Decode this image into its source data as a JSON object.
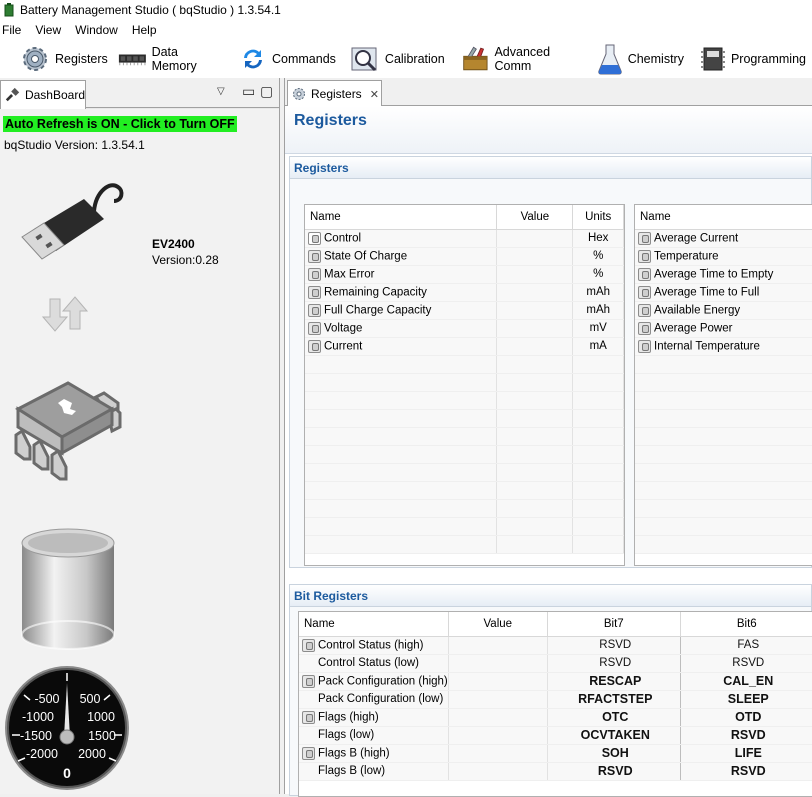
{
  "window": {
    "title": "Battery Management Studio ( bqStudio ) 1.3.54.1"
  },
  "menu": [
    "File",
    "View",
    "Window",
    "Help"
  ],
  "toolbar": [
    {
      "label": "Registers",
      "icon": "gear-icon"
    },
    {
      "label": "Data Memory",
      "icon": "memory-chip-icon"
    },
    {
      "label": "Commands",
      "icon": "refresh-arrows-icon"
    },
    {
      "label": "Calibration",
      "icon": "magnifier-calibration-icon"
    },
    {
      "label": "Advanced Comm",
      "icon": "toolbox-icon"
    },
    {
      "label": "Chemistry",
      "icon": "flask-icon"
    },
    {
      "label": "Programming",
      "icon": "programming-chip-icon"
    }
  ],
  "dashboard": {
    "tab_label": "DashBoard",
    "refresh_label": "Auto Refresh is ON - Click to Turn OFF",
    "version_label": "bqStudio Version:  1.3.54.1",
    "device_name": "EV2400",
    "device_version": "Version:0.28",
    "gauge": {
      "ticks": [
        "-500",
        "500",
        "-1000",
        "1000",
        "-1500",
        "1500",
        "-2000",
        "2000"
      ],
      "value": "0"
    }
  },
  "registers_tab": {
    "label": "Registers"
  },
  "page_title": "Registers",
  "registers_section": {
    "title": "Registers",
    "left_table": {
      "headers": {
        "name": "Name",
        "value": "Value",
        "units": "Units"
      },
      "rows": [
        {
          "name": "Control",
          "value": "",
          "units": "Hex",
          "icon": "edit"
        },
        {
          "name": "State Of Charge",
          "value": "",
          "units": "%",
          "icon": "lock"
        },
        {
          "name": "Max Error",
          "value": "",
          "units": "%",
          "icon": "lock"
        },
        {
          "name": "Remaining Capacity",
          "value": "",
          "units": "mAh",
          "icon": "lock"
        },
        {
          "name": "Full Charge Capacity",
          "value": "",
          "units": "mAh",
          "icon": "lock"
        },
        {
          "name": "Voltage",
          "value": "",
          "units": "mV",
          "icon": "lock"
        },
        {
          "name": "Current",
          "value": "",
          "units": "mA",
          "icon": "lock"
        }
      ]
    },
    "right_table": {
      "headers": {
        "name": "Name"
      },
      "rows": [
        "Average Current",
        "Temperature",
        "Average Time to Empty",
        "Average Time to Full",
        "Available Energy",
        "Average Power",
        "Internal Temperature"
      ]
    }
  },
  "bit_section": {
    "title": "Bit Registers",
    "headers": {
      "name": "Name",
      "value": "Value",
      "bit7": "Bit7",
      "bit6": "Bit6"
    },
    "rows": [
      {
        "name": "Control Status (high)",
        "lock": true,
        "bit7": "RSVD",
        "bit6": "FAS",
        "bold": false
      },
      {
        "name": "Control Status (low)",
        "lock": false,
        "bit7": "RSVD",
        "bit6": "RSVD",
        "bold": false
      },
      {
        "name": "Pack Configuration (high)",
        "lock": true,
        "bit7": "RESCAP",
        "bit6": "CAL_EN",
        "bold": true
      },
      {
        "name": "Pack Configuration (low)",
        "lock": false,
        "bit7": "RFACTSTEP",
        "bit6": "SLEEP",
        "bold": true
      },
      {
        "name": "Flags (high)",
        "lock": true,
        "bit7": "OTC",
        "bit6": "OTD",
        "bold": true
      },
      {
        "name": "Flags (low)",
        "lock": false,
        "bit7": "OCVTAKEN",
        "bit6": "RSVD",
        "bold": true
      },
      {
        "name": "Flags B (high)",
        "lock": true,
        "bit7": "SOH",
        "bit6": "LIFE",
        "bold": true
      },
      {
        "name": "Flags B (low)",
        "lock": false,
        "bit7": "RSVD",
        "bit6": "RSVD",
        "bold": true
      }
    ]
  },
  "colors": {
    "accent": "#1c5a9e",
    "refresh_bg": "#22ee22",
    "bit_cell": "#8c8c8c"
  }
}
